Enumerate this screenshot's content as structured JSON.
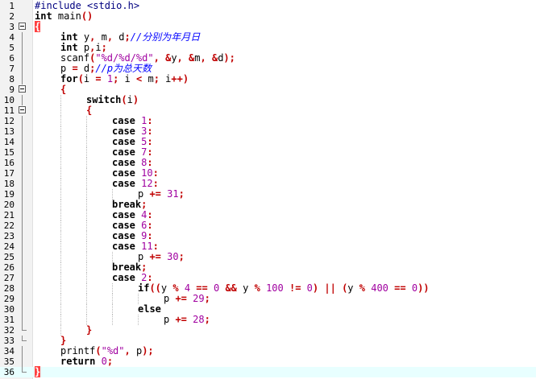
{
  "editor": {
    "current_line": 36,
    "colors": {
      "keyword": "#000000",
      "operator": "#c00000",
      "number": "#a000a0",
      "string": "#a000a0",
      "preprocessor": "#000080",
      "comment": "#0000ff",
      "current_line_bg": "#e8ffff",
      "brace_match_bg": "#ff4040"
    },
    "lines": [
      {
        "n": 1,
        "indent": 0,
        "fold": "none",
        "tokens": [
          [
            "pp",
            "#include <stdio.h>"
          ]
        ]
      },
      {
        "n": 2,
        "indent": 0,
        "fold": "none",
        "tokens": [
          [
            "kw",
            "int"
          ],
          [
            "id",
            " main"
          ],
          [
            "op",
            "()"
          ]
        ]
      },
      {
        "n": 3,
        "indent": 0,
        "fold": "open",
        "tokens": [
          [
            "hl",
            "{"
          ]
        ]
      },
      {
        "n": 4,
        "indent": 1,
        "fold": "line",
        "tokens": [
          [
            "kw",
            "int"
          ],
          [
            "id",
            " y"
          ],
          [
            "op",
            ","
          ],
          [
            "id",
            " m"
          ],
          [
            "op",
            ","
          ],
          [
            "id",
            " d"
          ],
          [
            "op",
            ";"
          ],
          [
            "cm",
            "//分别为年月日"
          ]
        ]
      },
      {
        "n": 5,
        "indent": 1,
        "fold": "line",
        "tokens": [
          [
            "kw",
            "int"
          ],
          [
            "id",
            " p"
          ],
          [
            "op",
            ","
          ],
          [
            "id",
            "i"
          ],
          [
            "op",
            ";"
          ]
        ]
      },
      {
        "n": 6,
        "indent": 1,
        "fold": "line",
        "tokens": [
          [
            "id",
            "scanf"
          ],
          [
            "op",
            "("
          ],
          [
            "str",
            "\"%d/%d/%d\""
          ],
          [
            "op",
            ","
          ],
          [
            "id",
            " "
          ],
          [
            "op",
            "&"
          ],
          [
            "id",
            "y"
          ],
          [
            "op",
            ","
          ],
          [
            "id",
            " "
          ],
          [
            "op",
            "&"
          ],
          [
            "id",
            "m"
          ],
          [
            "op",
            ","
          ],
          [
            "id",
            " "
          ],
          [
            "op",
            "&"
          ],
          [
            "id",
            "d"
          ],
          [
            "op",
            ");"
          ]
        ]
      },
      {
        "n": 7,
        "indent": 1,
        "fold": "line",
        "tokens": [
          [
            "id",
            "p "
          ],
          [
            "op",
            "="
          ],
          [
            "id",
            " d"
          ],
          [
            "op",
            ";"
          ],
          [
            "cm",
            "//p为总天数"
          ]
        ]
      },
      {
        "n": 8,
        "indent": 1,
        "fold": "line",
        "tokens": [
          [
            "kw",
            "for"
          ],
          [
            "op",
            "("
          ],
          [
            "id",
            "i "
          ],
          [
            "op",
            "="
          ],
          [
            "id",
            " "
          ],
          [
            "num",
            "1"
          ],
          [
            "op",
            ";"
          ],
          [
            "id",
            " i "
          ],
          [
            "op",
            "<"
          ],
          [
            "id",
            " m"
          ],
          [
            "op",
            ";"
          ],
          [
            "id",
            " i"
          ],
          [
            "op",
            "++)"
          ]
        ]
      },
      {
        "n": 9,
        "indent": 1,
        "fold": "open",
        "tokens": [
          [
            "op",
            "{"
          ]
        ]
      },
      {
        "n": 10,
        "indent": 2,
        "fold": "line",
        "tokens": [
          [
            "kw",
            "switch"
          ],
          [
            "op",
            "("
          ],
          [
            "id",
            "i"
          ],
          [
            "op",
            ")"
          ]
        ]
      },
      {
        "n": 11,
        "indent": 2,
        "fold": "open",
        "tokens": [
          [
            "op",
            "{"
          ]
        ]
      },
      {
        "n": 12,
        "indent": 3,
        "fold": "line",
        "tokens": [
          [
            "kw",
            "case"
          ],
          [
            "id",
            " "
          ],
          [
            "num",
            "1"
          ],
          [
            "op",
            ":"
          ]
        ]
      },
      {
        "n": 13,
        "indent": 3,
        "fold": "line",
        "tokens": [
          [
            "kw",
            "case"
          ],
          [
            "id",
            " "
          ],
          [
            "num",
            "3"
          ],
          [
            "op",
            ":"
          ]
        ]
      },
      {
        "n": 14,
        "indent": 3,
        "fold": "line",
        "tokens": [
          [
            "kw",
            "case"
          ],
          [
            "id",
            " "
          ],
          [
            "num",
            "5"
          ],
          [
            "op",
            ":"
          ]
        ]
      },
      {
        "n": 15,
        "indent": 3,
        "fold": "line",
        "tokens": [
          [
            "kw",
            "case"
          ],
          [
            "id",
            " "
          ],
          [
            "num",
            "7"
          ],
          [
            "op",
            ":"
          ]
        ]
      },
      {
        "n": 16,
        "indent": 3,
        "fold": "line",
        "tokens": [
          [
            "kw",
            "case"
          ],
          [
            "id",
            " "
          ],
          [
            "num",
            "8"
          ],
          [
            "op",
            ":"
          ]
        ]
      },
      {
        "n": 17,
        "indent": 3,
        "fold": "line",
        "tokens": [
          [
            "kw",
            "case"
          ],
          [
            "id",
            " "
          ],
          [
            "num",
            "10"
          ],
          [
            "op",
            ":"
          ]
        ]
      },
      {
        "n": 18,
        "indent": 3,
        "fold": "line",
        "tokens": [
          [
            "kw",
            "case"
          ],
          [
            "id",
            " "
          ],
          [
            "num",
            "12"
          ],
          [
            "op",
            ":"
          ]
        ]
      },
      {
        "n": 19,
        "indent": 4,
        "fold": "line",
        "tokens": [
          [
            "id",
            "p "
          ],
          [
            "op",
            "+="
          ],
          [
            "id",
            " "
          ],
          [
            "num",
            "31"
          ],
          [
            "op",
            ";"
          ]
        ]
      },
      {
        "n": 20,
        "indent": 3,
        "fold": "line",
        "tokens": [
          [
            "kw",
            "break"
          ],
          [
            "op",
            ";"
          ]
        ]
      },
      {
        "n": 21,
        "indent": 3,
        "fold": "line",
        "tokens": [
          [
            "kw",
            "case"
          ],
          [
            "id",
            " "
          ],
          [
            "num",
            "4"
          ],
          [
            "op",
            ":"
          ]
        ]
      },
      {
        "n": 22,
        "indent": 3,
        "fold": "line",
        "tokens": [
          [
            "kw",
            "case"
          ],
          [
            "id",
            " "
          ],
          [
            "num",
            "6"
          ],
          [
            "op",
            ":"
          ]
        ]
      },
      {
        "n": 23,
        "indent": 3,
        "fold": "line",
        "tokens": [
          [
            "kw",
            "case"
          ],
          [
            "id",
            " "
          ],
          [
            "num",
            "9"
          ],
          [
            "op",
            ":"
          ]
        ]
      },
      {
        "n": 24,
        "indent": 3,
        "fold": "line",
        "tokens": [
          [
            "kw",
            "case"
          ],
          [
            "id",
            " "
          ],
          [
            "num",
            "11"
          ],
          [
            "op",
            ":"
          ]
        ]
      },
      {
        "n": 25,
        "indent": 4,
        "fold": "line",
        "tokens": [
          [
            "id",
            "p "
          ],
          [
            "op",
            "+="
          ],
          [
            "id",
            " "
          ],
          [
            "num",
            "30"
          ],
          [
            "op",
            ";"
          ]
        ]
      },
      {
        "n": 26,
        "indent": 3,
        "fold": "line",
        "tokens": [
          [
            "kw",
            "break"
          ],
          [
            "op",
            ";"
          ]
        ]
      },
      {
        "n": 27,
        "indent": 3,
        "fold": "line",
        "tokens": [
          [
            "kw",
            "case"
          ],
          [
            "id",
            " "
          ],
          [
            "num",
            "2"
          ],
          [
            "op",
            ":"
          ]
        ]
      },
      {
        "n": 28,
        "indent": 4,
        "fold": "line",
        "tokens": [
          [
            "kw",
            "if"
          ],
          [
            "op",
            "(("
          ],
          [
            "id",
            "y "
          ],
          [
            "op",
            "%"
          ],
          [
            "id",
            " "
          ],
          [
            "num",
            "4"
          ],
          [
            "id",
            " "
          ],
          [
            "op",
            "=="
          ],
          [
            "id",
            " "
          ],
          [
            "num",
            "0"
          ],
          [
            "id",
            " "
          ],
          [
            "op",
            "&&"
          ],
          [
            "id",
            " y "
          ],
          [
            "op",
            "%"
          ],
          [
            "id",
            " "
          ],
          [
            "num",
            "100"
          ],
          [
            "id",
            " "
          ],
          [
            "op",
            "!="
          ],
          [
            "id",
            " "
          ],
          [
            "num",
            "0"
          ],
          [
            "op",
            ")"
          ],
          [
            "id",
            " "
          ],
          [
            "op",
            "||"
          ],
          [
            "id",
            " "
          ],
          [
            "op",
            "("
          ],
          [
            "id",
            "y "
          ],
          [
            "op",
            "%"
          ],
          [
            "id",
            " "
          ],
          [
            "num",
            "400"
          ],
          [
            "id",
            " "
          ],
          [
            "op",
            "=="
          ],
          [
            "id",
            " "
          ],
          [
            "num",
            "0"
          ],
          [
            "op",
            "))"
          ]
        ]
      },
      {
        "n": 29,
        "indent": 5,
        "fold": "line",
        "tokens": [
          [
            "id",
            "p "
          ],
          [
            "op",
            "+="
          ],
          [
            "id",
            " "
          ],
          [
            "num",
            "29"
          ],
          [
            "op",
            ";"
          ]
        ]
      },
      {
        "n": 30,
        "indent": 4,
        "fold": "line",
        "tokens": [
          [
            "kw",
            "else"
          ]
        ]
      },
      {
        "n": 31,
        "indent": 5,
        "fold": "line",
        "tokens": [
          [
            "id",
            "p "
          ],
          [
            "op",
            "+="
          ],
          [
            "id",
            " "
          ],
          [
            "num",
            "28"
          ],
          [
            "op",
            ";"
          ]
        ]
      },
      {
        "n": 32,
        "indent": 2,
        "fold": "end",
        "tokens": [
          [
            "op",
            "}"
          ]
        ]
      },
      {
        "n": 33,
        "indent": 1,
        "fold": "end",
        "tokens": [
          [
            "op",
            "}"
          ]
        ]
      },
      {
        "n": 34,
        "indent": 1,
        "fold": "line",
        "tokens": [
          [
            "id",
            "printf"
          ],
          [
            "op",
            "("
          ],
          [
            "str",
            "\"%d\""
          ],
          [
            "op",
            ","
          ],
          [
            "id",
            " p"
          ],
          [
            "op",
            ");"
          ]
        ]
      },
      {
        "n": 35,
        "indent": 1,
        "fold": "line",
        "tokens": [
          [
            "kw",
            "return"
          ],
          [
            "id",
            " "
          ],
          [
            "num",
            "0"
          ],
          [
            "op",
            ";"
          ]
        ]
      },
      {
        "n": 36,
        "indent": 0,
        "fold": "end",
        "tokens": [
          [
            "hl",
            "}"
          ]
        ]
      }
    ]
  }
}
